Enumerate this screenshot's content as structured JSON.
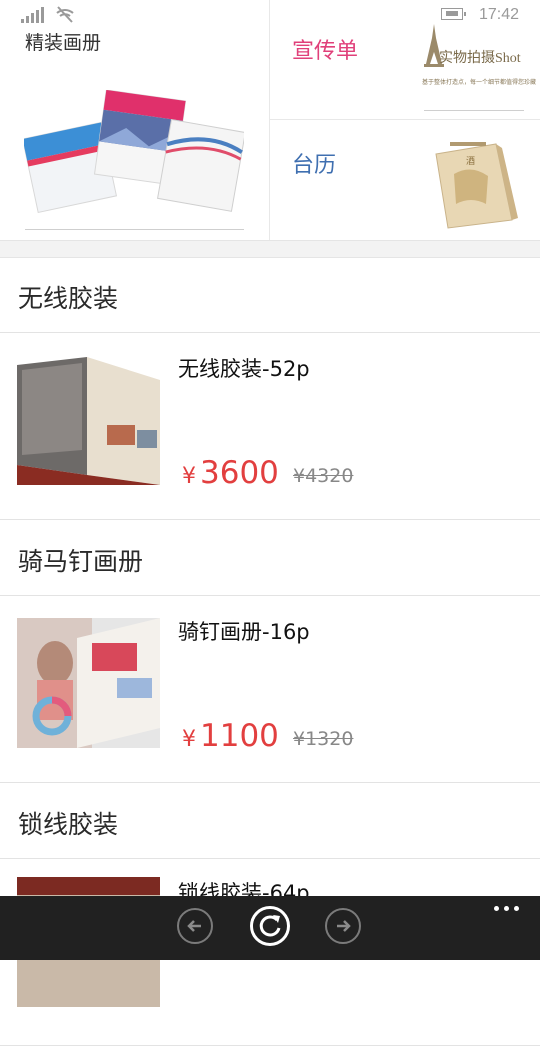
{
  "status": {
    "time": "17:42"
  },
  "categories": {
    "large": {
      "title": "精装画册"
    },
    "flyer": {
      "title": "宣传单",
      "logo_text": "实物拍摄Shot",
      "logo_sub": "基于整体打造点，每一个细节都值得您珍藏"
    },
    "calendar": {
      "title": "台历"
    }
  },
  "sections": [
    {
      "title": "无线胶装",
      "product": {
        "name": "无线胶装-52p",
        "currency": "¥",
        "price": "3600",
        "old_price": "¥4320"
      }
    },
    {
      "title": "骑马钉画册",
      "product": {
        "name": "骑钉画册-16p",
        "currency": "¥",
        "price": "1100",
        "old_price": "¥1320"
      }
    },
    {
      "title": "锁线胶装",
      "product": {
        "name": "锁线胶装-64p"
      }
    }
  ],
  "appbar": {
    "back_icon": "back-arrow-icon",
    "refresh_icon": "refresh-icon",
    "forward_icon": "forward-arrow-icon",
    "more_icon": "more-icon"
  }
}
